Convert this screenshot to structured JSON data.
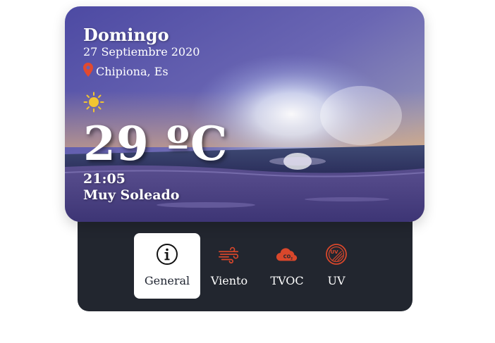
{
  "weather": {
    "day": "Domingo",
    "date": "27 Septiembre 2020",
    "location": "Chipiona, Es",
    "temperature": "29 ºC",
    "time": "21:05",
    "condition": "Muy Soleado",
    "condition_icon": "sun-icon",
    "location_icon": "map-pin-icon"
  },
  "tabs": [
    {
      "label": "General",
      "icon": "info-icon",
      "active": true
    },
    {
      "label": "Viento",
      "icon": "wind-icon",
      "active": false
    },
    {
      "label": "TVOC",
      "icon": "co2-cloud-icon",
      "active": false
    },
    {
      "label": "UV",
      "icon": "uv-icon",
      "active": false
    }
  ],
  "colors": {
    "accent": "#d9472b",
    "panel": "#22262f",
    "sun": "#f2c531"
  }
}
